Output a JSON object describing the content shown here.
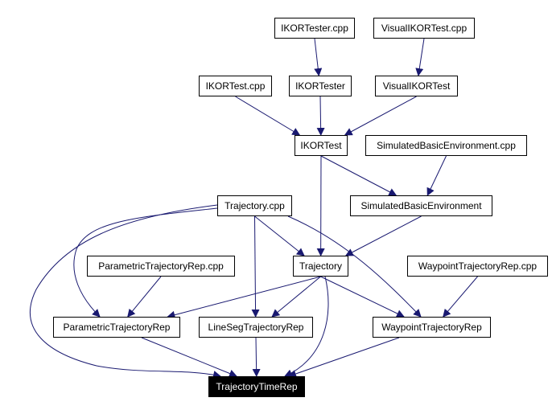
{
  "diagram": {
    "type": "include-dependency-graph",
    "edge_color": "#191970",
    "focus_node_bg": "#000000",
    "nodes": [
      {
        "id": "IKORTester_cpp",
        "label": "IKORTester.cpp"
      },
      {
        "id": "VisualIKORTest_cpp",
        "label": "VisualIKORTest.cpp"
      },
      {
        "id": "IKORTest_cpp",
        "label": "IKORTest.cpp"
      },
      {
        "id": "IKORTester",
        "label": "IKORTester"
      },
      {
        "id": "VisualIKORTest",
        "label": "VisualIKORTest"
      },
      {
        "id": "IKORTest",
        "label": "IKORTest"
      },
      {
        "id": "SimulatedBasicEnvironment_cpp",
        "label": "SimulatedBasicEnvironment.cpp"
      },
      {
        "id": "Trajectory_cpp",
        "label": "Trajectory.cpp"
      },
      {
        "id": "SimulatedBasicEnvironment",
        "label": "SimulatedBasicEnvironment"
      },
      {
        "id": "ParametricTrajectoryRep_cpp",
        "label": "ParametricTrajectoryRep.cpp"
      },
      {
        "id": "Trajectory",
        "label": "Trajectory"
      },
      {
        "id": "WaypointTrajectoryRep_cpp",
        "label": "WaypointTrajectoryRep.cpp"
      },
      {
        "id": "ParametricTrajectoryRep",
        "label": "ParametricTrajectoryRep"
      },
      {
        "id": "LineSegTrajectoryRep",
        "label": "LineSegTrajectoryRep"
      },
      {
        "id": "WaypointTrajectoryRep",
        "label": "WaypointTrajectoryRep"
      },
      {
        "id": "TrajectoryTimeRep",
        "label": "TrajectoryTimeRep",
        "focus": true
      }
    ],
    "edges": [
      {
        "from": "IKORTester_cpp",
        "to": "IKORTester"
      },
      {
        "from": "VisualIKORTest_cpp",
        "to": "VisualIKORTest"
      },
      {
        "from": "IKORTest_cpp",
        "to": "IKORTest"
      },
      {
        "from": "IKORTester",
        "to": "IKORTest"
      },
      {
        "from": "VisualIKORTest",
        "to": "IKORTest"
      },
      {
        "from": "IKORTest",
        "to": "SimulatedBasicEnvironment"
      },
      {
        "from": "IKORTest",
        "to": "Trajectory"
      },
      {
        "from": "SimulatedBasicEnvironment_cpp",
        "to": "SimulatedBasicEnvironment"
      },
      {
        "from": "SimulatedBasicEnvironment",
        "to": "Trajectory"
      },
      {
        "from": "Trajectory_cpp",
        "to": "Trajectory"
      },
      {
        "from": "Trajectory_cpp",
        "to": "ParametricTrajectoryRep"
      },
      {
        "from": "Trajectory_cpp",
        "to": "LineSegTrajectoryRep"
      },
      {
        "from": "Trajectory_cpp",
        "to": "WaypointTrajectoryRep"
      },
      {
        "from": "Trajectory_cpp",
        "to": "TrajectoryTimeRep"
      },
      {
        "from": "ParametricTrajectoryRep_cpp",
        "to": "ParametricTrajectoryRep"
      },
      {
        "from": "WaypointTrajectoryRep_cpp",
        "to": "WaypointTrajectoryRep"
      },
      {
        "from": "Trajectory",
        "to": "ParametricTrajectoryRep"
      },
      {
        "from": "Trajectory",
        "to": "LineSegTrajectoryRep"
      },
      {
        "from": "Trajectory",
        "to": "WaypointTrajectoryRep"
      },
      {
        "from": "Trajectory",
        "to": "TrajectoryTimeRep"
      },
      {
        "from": "ParametricTrajectoryRep",
        "to": "TrajectoryTimeRep"
      },
      {
        "from": "LineSegTrajectoryRep",
        "to": "TrajectoryTimeRep"
      },
      {
        "from": "WaypointTrajectoryRep",
        "to": "TrajectoryTimeRep"
      }
    ]
  }
}
